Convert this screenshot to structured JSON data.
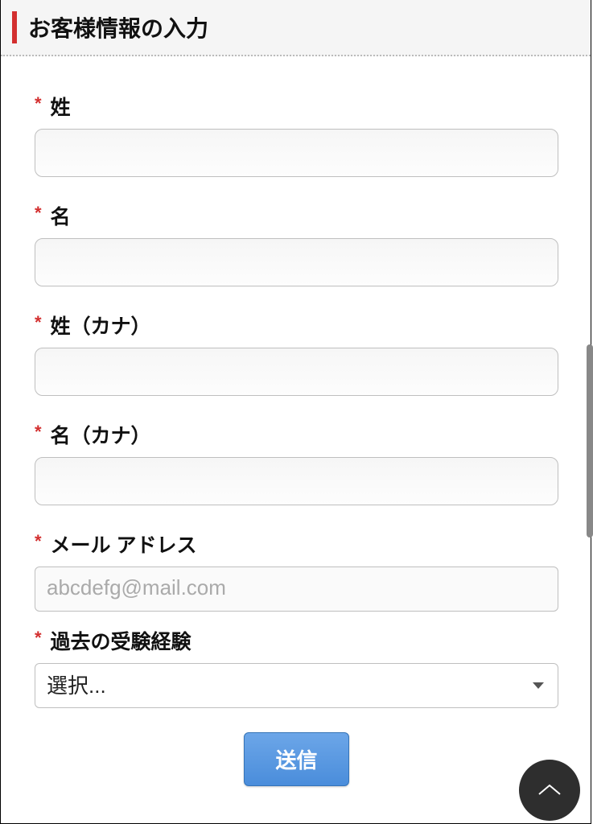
{
  "header": {
    "title": "お客様情報の入力"
  },
  "form": {
    "required_mark": "*",
    "fields": {
      "last_name": {
        "label": "姓",
        "value": ""
      },
      "first_name": {
        "label": "名",
        "value": ""
      },
      "last_name_kana": {
        "label": "姓（カナ）",
        "value": ""
      },
      "first_name_kana": {
        "label": "名（カナ）",
        "value": ""
      },
      "email": {
        "label": "メール アドレス",
        "placeholder": "abcdefg@mail.com",
        "value": ""
      },
      "exam_history": {
        "label": "過去の受験経験",
        "selected": "選択..."
      }
    },
    "submit_label": "送信"
  }
}
